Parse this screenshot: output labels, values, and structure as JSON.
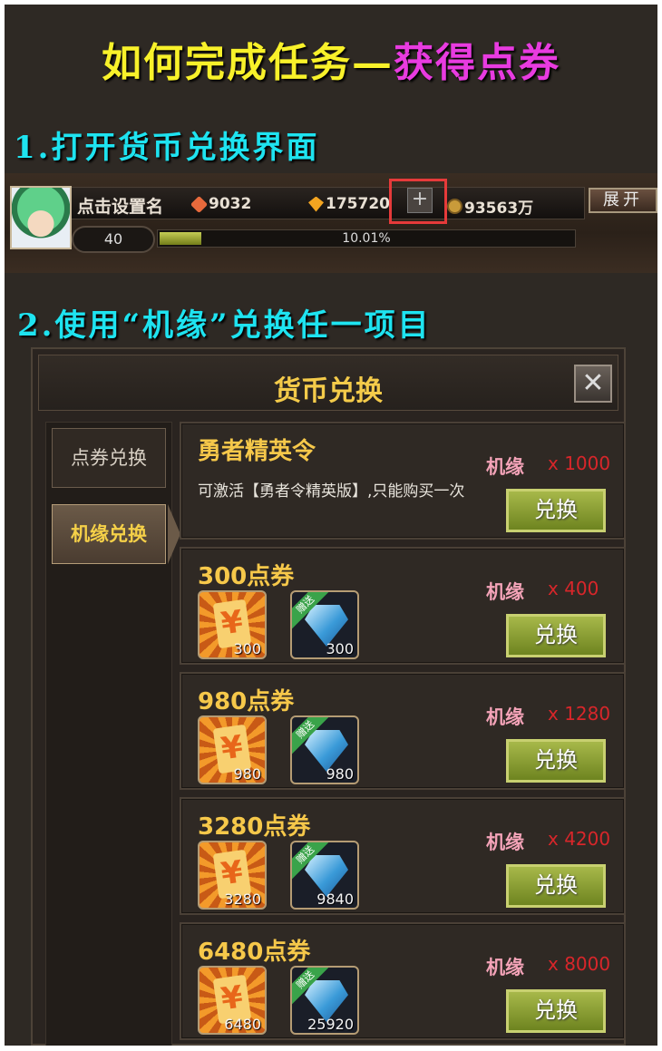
{
  "heading": {
    "part1": "如何完成任务—",
    "part2": "获得点券"
  },
  "step1": "1.打开货币兑换界面",
  "step2": "2.使用“机缘”兑换任一项目",
  "status_bar": {
    "player_name": "点击设置名",
    "currency1": "9032",
    "currency2": "175720",
    "plus_label": "+",
    "currency3": "93563万",
    "expand_label": "展开",
    "level": "40",
    "xp_percent": "10.01%",
    "xp_fraction": 0.1001
  },
  "panel": {
    "title": "货币兑换",
    "close_label": "✕",
    "tabs": [
      {
        "label": "点券兑换"
      },
      {
        "label": "机缘兑换"
      }
    ],
    "cards": [
      {
        "title": "勇者精英令",
        "desc": "可激活【勇者令精英版】,只能购买一次",
        "cost_name": "机缘",
        "cost_qty": "x 1000",
        "button": "兑换"
      },
      {
        "title": "300点券",
        "coupon_count": "300",
        "gift_label": "赠送",
        "gem_count": "300",
        "cost_name": "机缘",
        "cost_qty": "x 400",
        "button": "兑换"
      },
      {
        "title": "980点券",
        "coupon_count": "980",
        "gift_label": "赠送",
        "gem_count": "980",
        "cost_name": "机缘",
        "cost_qty": "x 1280",
        "button": "兑换"
      },
      {
        "title": "3280点券",
        "coupon_count": "3280",
        "gift_label": "赠送",
        "gem_count": "9840",
        "cost_name": "机缘",
        "cost_qty": "x 4200",
        "button": "兑换"
      },
      {
        "title": "6480点券",
        "coupon_count": "6480",
        "gift_label": "赠送",
        "gem_count": "25920",
        "cost_name": "机缘",
        "cost_qty": "x 8000",
        "button": "兑换"
      }
    ]
  },
  "colors": {
    "highlight": "#e63a3a",
    "heading_yellow": "#f8f12a",
    "heading_magenta": "#e83be0",
    "step_cyan": "#1ee3f0"
  }
}
